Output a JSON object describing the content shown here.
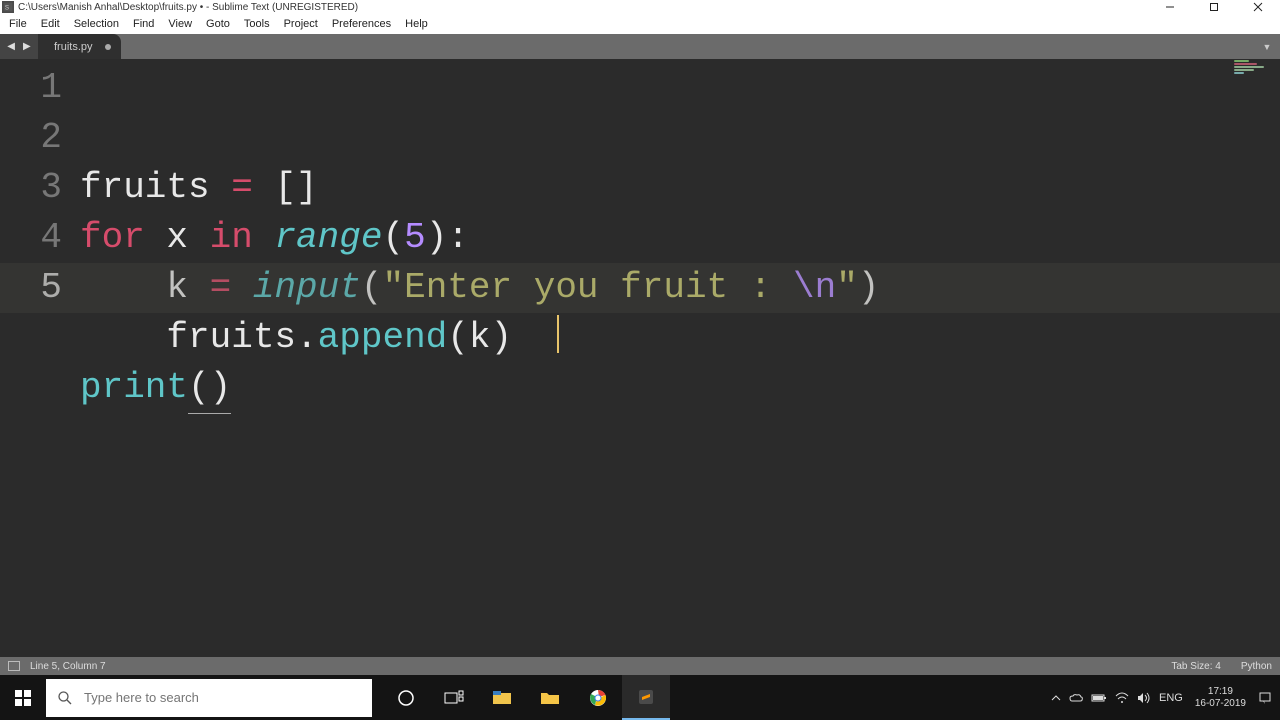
{
  "title_bar": {
    "path_title": "C:\\Users\\Manish Anhal\\Desktop\\fruits.py • - Sublime Text (UNREGISTERED)"
  },
  "menu": [
    "File",
    "Edit",
    "Selection",
    "Find",
    "View",
    "Goto",
    "Tools",
    "Project",
    "Preferences",
    "Help"
  ],
  "tab": {
    "name": "fruits.py"
  },
  "code_lines": {
    "l1_a": "fruits ",
    "l1_op": "=",
    "l1_b": " []",
    "l2_for": "for",
    "l2_x": " x ",
    "l2_in": "in",
    "l2_sp": " ",
    "l2_range": "range",
    "l2_op": "(",
    "l2_num": "5",
    "l2_cp": "):",
    "l3_a": "    k ",
    "l3_op": "=",
    "l3_b": " ",
    "l3_input": "input",
    "l3_op2": "(",
    "l3_q1": "\"",
    "l3_str": "Enter you fruit : ",
    "l3_esc": "\\n",
    "l3_q2": "\"",
    "l3_cp": ")",
    "l4_a": "    fruits",
    "l4_dot": ".",
    "l4_app": "append",
    "l4_op": "(k)",
    "l5_print": "print",
    "l5_p": "()"
  },
  "line_numbers": [
    "1",
    "2",
    "3",
    "4",
    "5"
  ],
  "status": {
    "position": "Line 5, Column 7",
    "tabsize": "Tab Size: 4",
    "lang": "Python"
  },
  "search": {
    "placeholder": "Type here to search"
  },
  "tray": {
    "lang": "ENG",
    "time": "17:19",
    "date": "16-07-2019"
  }
}
